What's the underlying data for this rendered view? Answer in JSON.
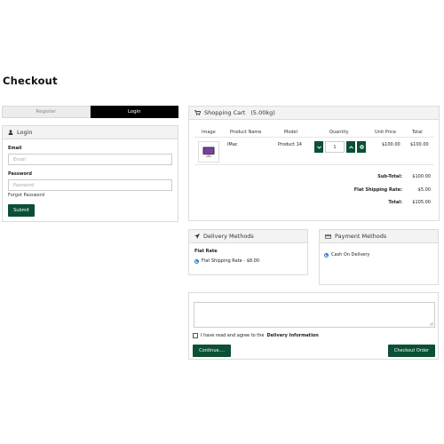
{
  "page": {
    "title": "Checkout"
  },
  "login": {
    "tabs": {
      "register": "Register",
      "login": "Login"
    },
    "header": "Login",
    "email_label": "Email",
    "email_placeholder": "Email",
    "password_label": "Password",
    "password_placeholder": "Password",
    "forgot": "Forgot Password",
    "submit": "Submit"
  },
  "cart": {
    "header": "Shopping Cart",
    "weight": "(5.00kg)",
    "columns": {
      "image": "Image",
      "name": "Product Name",
      "model": "Model",
      "quantity": "Quantity",
      "unit_price": "Unit Price",
      "total": "Total"
    },
    "items": [
      {
        "name": "iMac",
        "model": "Product 14",
        "quantity": "1",
        "unit_price": "$100.00",
        "total": "$100.00"
      }
    ],
    "totals": [
      {
        "label": "Sub-Total:",
        "value": "$100.00"
      },
      {
        "label": "Flat Shipping Rate:",
        "value": "$5.00"
      },
      {
        "label": "Total:",
        "value": "$105.00"
      }
    ]
  },
  "delivery": {
    "header": "Delivery Methods",
    "group": "Flat Rate",
    "option": "Flat Shipping Rate - $8.00"
  },
  "payment": {
    "header": "Payment Methods",
    "option": "Cash On Delivery"
  },
  "confirm": {
    "agree_prefix": "I have read and agree to the",
    "agree_link": "Delivery Information",
    "continue": "Continue....",
    "checkout": "Checkout Order"
  },
  "colors": {
    "accent": "#0b5035",
    "tab_active": "#000000",
    "radio": "#1a6fd1"
  }
}
